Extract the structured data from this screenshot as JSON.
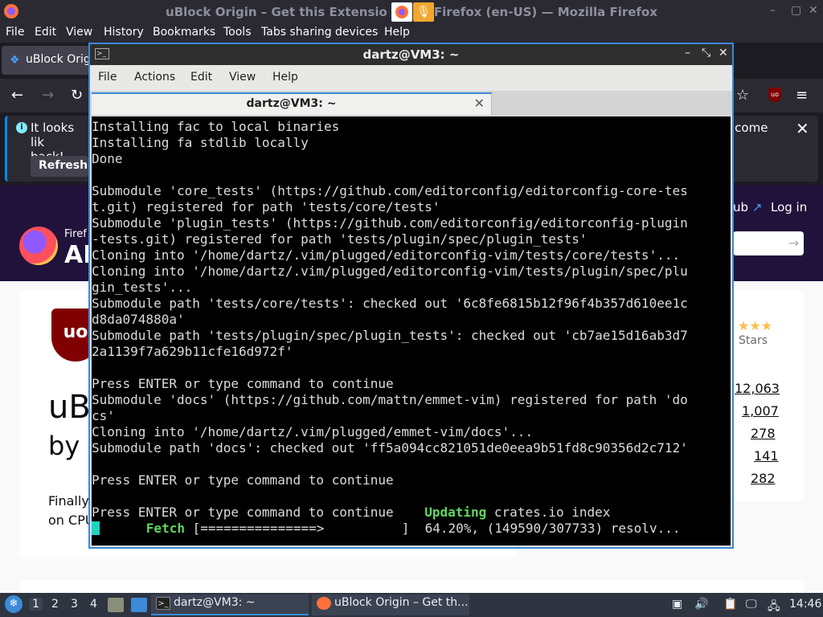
{
  "firefox": {
    "window_title": "uBlock Origin – Get this Extension for  Firefox (en-US) — Mozilla Firefox",
    "title_left": "uBlock Origin – Get this Extensio",
    "title_right": "Firefox (en-US) — Mozilla Firefox",
    "menu": [
      "File",
      "Edit",
      "View",
      "History",
      "Bookmarks",
      "Tools",
      "Tabs sharing devices",
      "Help"
    ],
    "tab_label": "uBlock Origi",
    "notice_text_1": "It looks lik",
    "notice_text_2": "back!",
    "notice_text_right": "lcome",
    "notice_button": "Refresh",
    "page": {
      "brand_small": "Firef",
      "brand_large": "AD",
      "hub_link": "ub",
      "login": "Log in",
      "addon_short": "uB",
      "by_short": "by",
      "desc_1": "Finally,",
      "desc_2": "on CPU",
      "stars_label": "Stars",
      "rating_counts": [
        "12,063",
        "1,007",
        "278",
        "141",
        "282"
      ],
      "logo_text": "uo"
    }
  },
  "terminal": {
    "window_title": "dartz@VM3: ~",
    "menu": [
      "File",
      "Actions",
      "Edit",
      "View",
      "Help"
    ],
    "tab_label": "dartz@VM3: ~",
    "lines": [
      "Installing fac to local binaries",
      "Installing fa stdlib locally",
      "Done",
      "",
      "Submodule 'core_tests' (https://github.com/editorconfig/editorconfig-core-tes",
      "t.git) registered for path 'tests/core/tests'",
      "Submodule 'plugin_tests' (https://github.com/editorconfig/editorconfig-plugin",
      "-tests.git) registered for path 'tests/plugin/spec/plugin_tests'",
      "Cloning into '/home/dartz/.vim/plugged/editorconfig-vim/tests/core/tests'...",
      "Cloning into '/home/dartz/.vim/plugged/editorconfig-vim/tests/plugin/spec/plu",
      "gin_tests'...",
      "Submodule path 'tests/core/tests': checked out '6c8fe6815b12f96f4b357d610ee1c",
      "d8da074880a'",
      "Submodule path 'tests/plugin/spec/plugin_tests': checked out 'cb7ae15d16ab3d7",
      "2a1139f7a629b11cfe16d972f'",
      "",
      "Press ENTER or type command to continue",
      "Submodule 'docs' (https://github.com/mattn/emmet-vim) registered for path 'do",
      "cs'",
      "Cloning into '/home/dartz/.vim/plugged/emmet-vim/docs'...",
      "Submodule path 'docs': checked out 'ff5a094cc821051de0eea9b51fd8c90356d2c712'",
      "",
      "Press ENTER or type command to continue",
      ""
    ],
    "line_updating_prefix": "Press ENTER or type command to continue    ",
    "line_updating_word": "Updating",
    "line_updating_rest": " crates.io index",
    "line_fetch_pad": "      ",
    "line_fetch_word": "Fetch",
    "line_fetch_rest": " [===============>          ]  64.20%, (149590/307733) resolv..."
  },
  "taskbar": {
    "workspaces": [
      "1",
      "2",
      "3",
      "4"
    ],
    "task_terminal": "dartz@VM3: ~",
    "task_firefox": "uBlock Origin – Get th...",
    "clock": "14:46"
  },
  "colors": {
    "terminal_accent": "#3c8ad8",
    "terminal_green": "#5fd75f",
    "cursor": "#19d5c2",
    "ublock_red": "#800000"
  }
}
